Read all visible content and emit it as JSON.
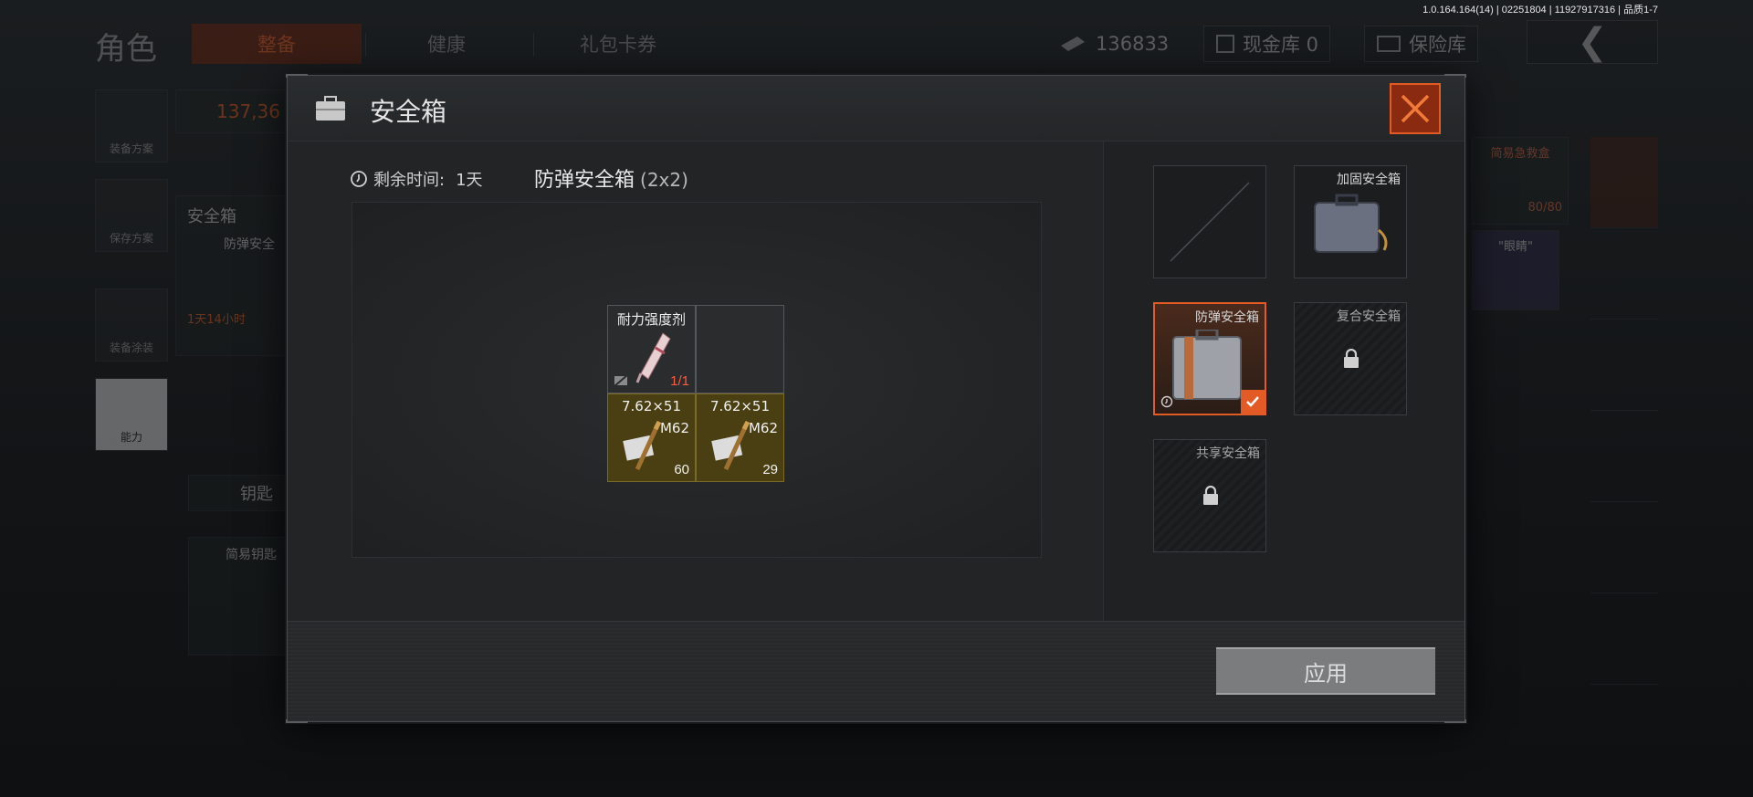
{
  "version_info": "1.0.164.164(14) | 02251804 | 11927917316 | 品质1-7",
  "background": {
    "page_title": "角色",
    "tabs": [
      {
        "label": "整备",
        "active": true
      },
      {
        "label": "健康",
        "active": false
      },
      {
        "label": "礼包卡券",
        "active": false
      }
    ],
    "money": "136833",
    "cash_vault": "现金库 0",
    "insurance_vault": "保险库",
    "left_rail": [
      {
        "label": "装备方案",
        "icon": "vest-icon"
      },
      {
        "label": "保存方案",
        "icon": "download-icon"
      },
      {
        "label": "装备涂装",
        "icon": "helmet-icon"
      },
      {
        "label": "能力",
        "icon": "ability-icon"
      }
    ],
    "value_text": "137,36",
    "safe_box_label": "安全箱",
    "safe_box_item": "防弹安全",
    "safe_box_timer": "1天14小时",
    "key_label": "钥匙",
    "key_item": "简易钥匙",
    "medkit_label": "简易急救盒",
    "medkit_count": "80/80",
    "badge_label": "\"眼睛\""
  },
  "modal": {
    "title": "安全箱",
    "remaining_label": "剩余时间:",
    "remaining_value": "1天",
    "case_name": "防弹安全箱",
    "case_size": "(2x2)",
    "slots": [
      {
        "name": "耐力强度剂",
        "sub": "",
        "count": "1/1",
        "count_color": "red",
        "type": "item"
      },
      {
        "name": "",
        "sub": "",
        "count": "",
        "type": "empty"
      },
      {
        "name": "7.62×51",
        "sub": "M62",
        "count": "60",
        "type": "ammo"
      },
      {
        "name": "7.62×51",
        "sub": "M62",
        "count": "29",
        "type": "ammo"
      }
    ],
    "cases": [
      {
        "label": "",
        "state": "empty"
      },
      {
        "label": "加固安全箱",
        "state": "available"
      },
      {
        "label": "防弹安全箱",
        "state": "selected"
      },
      {
        "label": "复合安全箱",
        "state": "locked"
      },
      {
        "label": "共享安全箱",
        "state": "locked"
      }
    ],
    "apply_label": "应用"
  },
  "colors": {
    "accent": "#e25b24",
    "ammo_bg": "#4a3f12",
    "count_red": "#ff5a3c"
  }
}
